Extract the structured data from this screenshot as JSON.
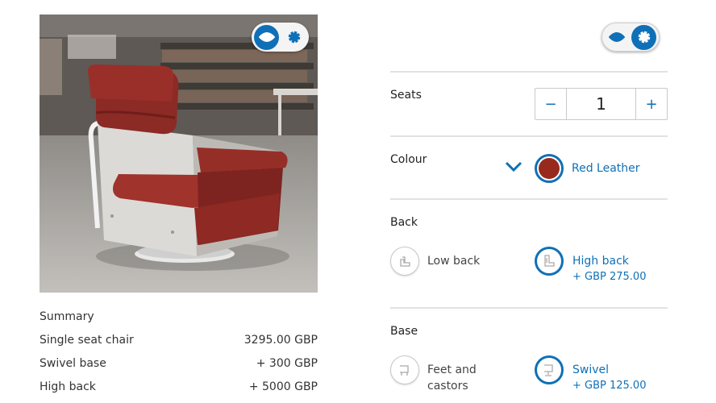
{
  "product_image": {
    "alt": "Red leather swivel armchair in a library"
  },
  "view_toggle": {
    "view_icon": "eye-icon",
    "settings_icon": "gear-icon"
  },
  "summary": {
    "title": "Summary",
    "rows": [
      {
        "label": "Single seat chair",
        "value": "3295.00 GBP"
      },
      {
        "label": "Swivel base",
        "value": "+ 300 GBP"
      },
      {
        "label": "High back",
        "value": "+ 5000 GBP"
      }
    ]
  },
  "config": {
    "seats": {
      "label": "Seats",
      "value": "1",
      "decrement": "−",
      "increment": "+"
    },
    "colour": {
      "label": "Colour",
      "selected": "Red Leather",
      "swatch_color": "#98291d"
    },
    "back": {
      "label": "Back",
      "options": [
        {
          "name": "Low back",
          "price": "",
          "selected": false
        },
        {
          "name": "High back",
          "price": "+ GBP 275.00",
          "selected": true
        }
      ]
    },
    "base": {
      "label": "Base",
      "options": [
        {
          "name": "Feet and\ncastors",
          "price": "",
          "selected": false
        },
        {
          "name": "Swivel",
          "price": "+ GBP 125.00",
          "selected": true
        }
      ]
    }
  },
  "colors": {
    "accent": "#0f70b7",
    "divider": "#e2e2e2",
    "text": "#333333"
  }
}
